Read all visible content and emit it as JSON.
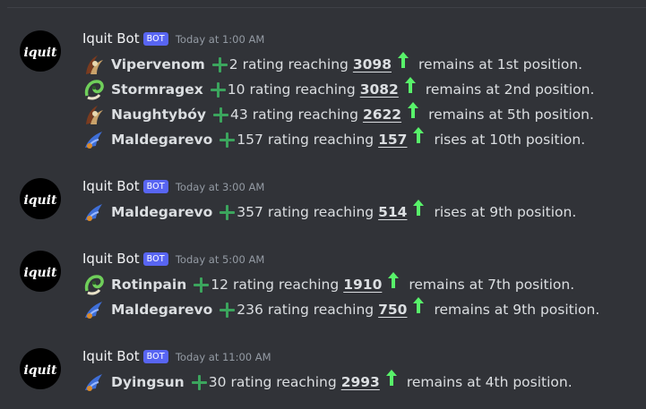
{
  "colors": {
    "background": "#313338",
    "bot_badge": "#5865f2",
    "plus_green": "#3ba55d",
    "arrow_green": "#58f26a"
  },
  "bot": {
    "name": "Iquit Bot",
    "badge": "BOT",
    "avatar_text": "iquit"
  },
  "labels": {
    "rating_reaching": "rating reaching"
  },
  "messages": [
    {
      "timestamp": "Today at 1:00 AM",
      "lines": [
        {
          "icon": "rank-horns-icon",
          "name": "Vipervenom",
          "delta": "2",
          "value": "3098",
          "status": "remains at 1st position."
        },
        {
          "icon": "rank-snake-icon",
          "name": "Stormragex",
          "delta": "10",
          "value": "3082",
          "status": "remains at 2nd position."
        },
        {
          "icon": "rank-horns-icon",
          "name": "Naughtybóy",
          "delta": "43",
          "value": "2622",
          "status": "remains at 5th position."
        },
        {
          "icon": "rank-wing-icon",
          "name": "Maldegarevo",
          "delta": "157",
          "value": "157",
          "status": "rises at 10th position."
        }
      ]
    },
    {
      "timestamp": "Today at 3:00 AM",
      "lines": [
        {
          "icon": "rank-wing-icon",
          "name": "Maldegarevo",
          "delta": "357",
          "value": "514",
          "status": "rises at 9th position."
        }
      ]
    },
    {
      "timestamp": "Today at 5:00 AM",
      "lines": [
        {
          "icon": "rank-snake-icon",
          "name": "Rotinpain",
          "delta": "12",
          "value": "1910",
          "status": "remains at 7th position."
        },
        {
          "icon": "rank-wing-icon",
          "name": "Maldegarevo",
          "delta": "236",
          "value": "750",
          "status": "remains at 9th position."
        }
      ]
    },
    {
      "timestamp": "Today at 11:00 AM",
      "lines": [
        {
          "icon": "rank-wing-icon",
          "name": "Dyingsun",
          "delta": "30",
          "value": "2993",
          "status": "remains at 4th position."
        }
      ]
    }
  ]
}
